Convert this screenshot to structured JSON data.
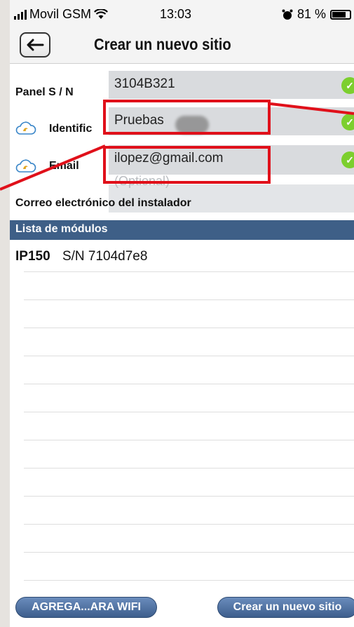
{
  "status_bar": {
    "carrier": "Movil GSM",
    "time": "13:03",
    "battery_percent": "81 %",
    "battery_level": 0.81
  },
  "nav": {
    "title": "Crear un nuevo sitio",
    "back_icon": "arrow-left-icon"
  },
  "form": {
    "panel_sn": {
      "label": "Panel S / N",
      "value": "3104B321"
    },
    "identifier": {
      "label": "Identific",
      "value": "Pruebas"
    },
    "email": {
      "label": "Email",
      "value": "ilopez@gmail.com"
    },
    "installer_email": {
      "label": "Correo electrónico del instalador",
      "placeholder": "(Optional)"
    }
  },
  "modules": {
    "header": "Lista de módulos",
    "items": [
      {
        "model": "IP150",
        "serial": "S/N 7104d7e8"
      }
    ]
  },
  "buttons": {
    "add_wifi": "AGREGA...ARA WIFI",
    "create_site": "Crear un nuevo sitio"
  },
  "colors": {
    "accent": "#3e5f87",
    "highlight_box": "#e0101a",
    "check": "#7ccf2e"
  }
}
